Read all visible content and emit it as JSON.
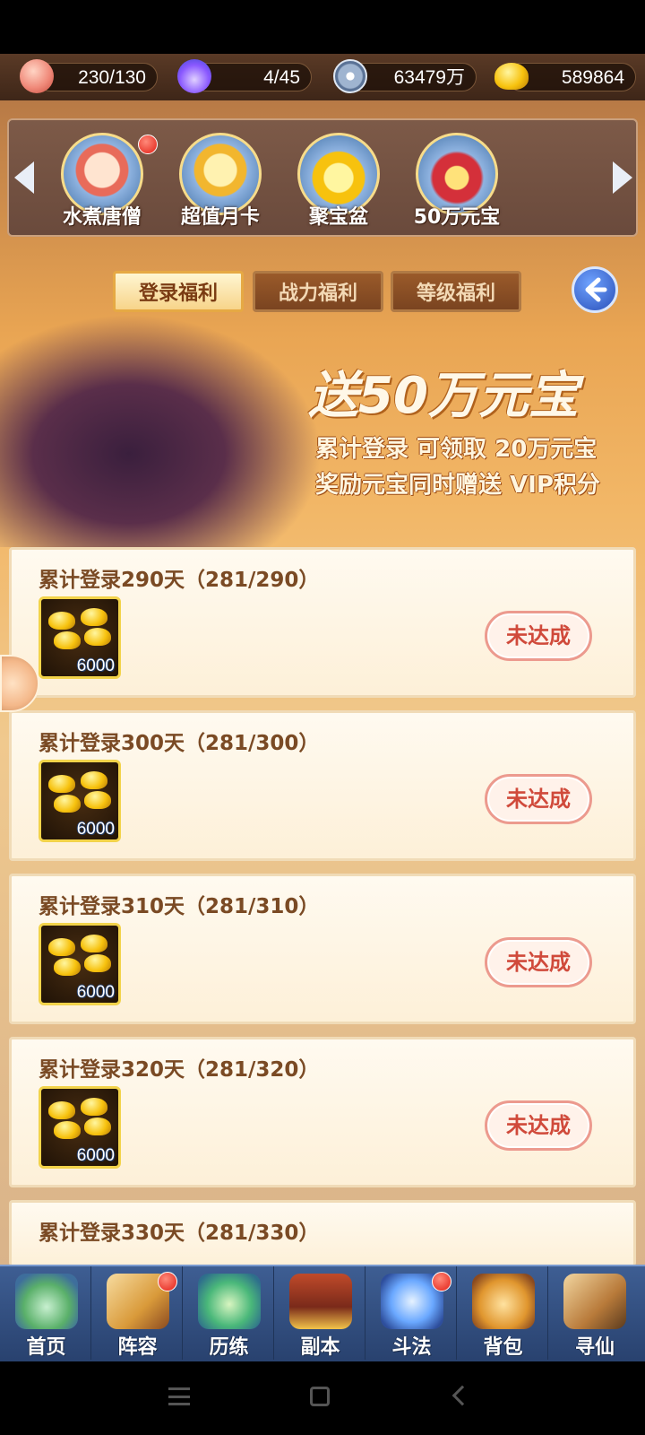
{
  "resources": [
    {
      "icon": "peach-icon",
      "value": "230/130"
    },
    {
      "icon": "spirit-flame-icon",
      "value": "4/45"
    },
    {
      "icon": "copper-coin-icon",
      "value": "63479万"
    },
    {
      "icon": "gold-ingot-icon",
      "value": "589864"
    }
  ],
  "carousel": {
    "items": [
      {
        "label": "水煮唐僧",
        "icon": "tang-monk-icon",
        "badge": true
      },
      {
        "label": "超值月卡",
        "icon": "monthly-card-icon",
        "badge": false
      },
      {
        "label": "聚宝盆",
        "icon": "treasure-bowl-icon",
        "badge": false
      },
      {
        "label": "50万元宝",
        "icon": "treasure-chest-icon",
        "badge": false
      }
    ]
  },
  "tabs": [
    {
      "label": "登录福利",
      "active": true
    },
    {
      "label": "战力福利",
      "active": false
    },
    {
      "label": "等级福利",
      "active": false
    }
  ],
  "banner": {
    "title": "送50万元宝",
    "line1": "累计登录 可领取 20万元宝",
    "line2": "奖励元宝同时赠送 VIP积分"
  },
  "rewards": [
    {
      "title": "累计登录290天（281/290）",
      "qty": "6000",
      "status": "未达成"
    },
    {
      "title": "累计登录300天（281/300）",
      "qty": "6000",
      "status": "未达成"
    },
    {
      "title": "累计登录310天（281/310）",
      "qty": "6000",
      "status": "未达成"
    },
    {
      "title": "累计登录320天（281/320）",
      "qty": "6000",
      "status": "未达成"
    },
    {
      "title": "累计登录330天（281/330）",
      "qty": "",
      "status": ""
    }
  ],
  "nav": [
    {
      "label": "首页",
      "icon": "home-island-icon",
      "badge": false
    },
    {
      "label": "阵容",
      "icon": "lineup-cards-icon",
      "badge": true
    },
    {
      "label": "历练",
      "icon": "training-gourd-icon",
      "badge": false
    },
    {
      "label": "副本",
      "icon": "dungeon-gate-icon",
      "badge": false
    },
    {
      "label": "斗法",
      "icon": "battle-sword-icon",
      "badge": true
    },
    {
      "label": "背包",
      "icon": "backpack-icon",
      "badge": false
    },
    {
      "label": "寻仙",
      "icon": "scroll-quest-icon",
      "badge": false
    }
  ],
  "colors": {
    "accent": "#d04a3b",
    "gold": "#f7c20e",
    "nav": "#2f4a7c"
  }
}
